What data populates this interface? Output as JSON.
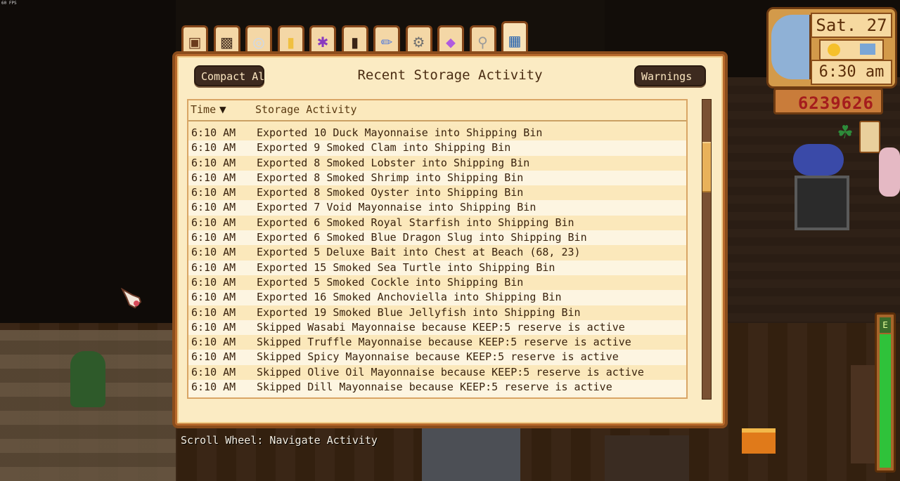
{
  "overlay": {
    "fps_label": "60 FPS"
  },
  "hud": {
    "date": "Sat. 27",
    "time": "6:30 am",
    "money": "6239626"
  },
  "tabs": [
    {
      "name": "tab-chest-icon",
      "color": "#6b3b1c"
    },
    {
      "name": "tab-tiki-icon",
      "color": "#4a3322"
    },
    {
      "name": "tab-ring-icon",
      "color": "#c8d8f0"
    },
    {
      "name": "tab-tag-icon",
      "color": "#f0c040"
    },
    {
      "name": "tab-star-figure-icon",
      "color": "#8a3ac0"
    },
    {
      "name": "tab-barrel-icon",
      "color": "#3a2416"
    },
    {
      "name": "tab-wand-icon",
      "color": "#5a7fd8"
    },
    {
      "name": "tab-gear-icon",
      "color": "#6f6f6f"
    },
    {
      "name": "tab-gem-icon",
      "color": "#b05ae0"
    },
    {
      "name": "tab-magnifier-icon",
      "color": "#9a9a9a"
    },
    {
      "name": "tab-book-icon",
      "color": "#1f5fb0"
    }
  ],
  "panel": {
    "title": "Recent Storage Activity",
    "compact_label": "Compact All",
    "warnings_label": "Warnings",
    "columns": {
      "time": "Time",
      "activity": "Storage Activity"
    }
  },
  "rows": [
    {
      "time": "6:10 AM",
      "activity": "Exported 10 Duck Mayonnaise into Shipping Bin"
    },
    {
      "time": "6:10 AM",
      "activity": "Exported 9 Smoked Clam into Shipping Bin"
    },
    {
      "time": "6:10 AM",
      "activity": "Exported 8 Smoked Lobster into Shipping Bin"
    },
    {
      "time": "6:10 AM",
      "activity": "Exported 8 Smoked Shrimp into Shipping Bin"
    },
    {
      "time": "6:10 AM",
      "activity": "Exported 8 Smoked Oyster into Shipping Bin"
    },
    {
      "time": "6:10 AM",
      "activity": "Exported 7 Void Mayonnaise into Shipping Bin"
    },
    {
      "time": "6:10 AM",
      "activity": "Exported 6 Smoked Royal Starfish into Shipping Bin"
    },
    {
      "time": "6:10 AM",
      "activity": "Exported 6 Smoked Blue Dragon Slug into Shipping Bin"
    },
    {
      "time": "6:10 AM",
      "activity": "Exported 5 Deluxe Bait into Chest at Beach (68, 23)"
    },
    {
      "time": "6:10 AM",
      "activity": "Exported 15 Smoked Sea Turtle into Shipping Bin"
    },
    {
      "time": "6:10 AM",
      "activity": "Exported 5 Smoked Cockle into Shipping Bin"
    },
    {
      "time": "6:10 AM",
      "activity": "Exported 16 Smoked Anchoviella into Shipping Bin"
    },
    {
      "time": "6:10 AM",
      "activity": "Exported 19 Smoked Blue Jellyfish into Shipping Bin"
    },
    {
      "time": "6:10 AM",
      "activity": "Skipped Wasabi Mayonnaise because KEEP:5 reserve is active"
    },
    {
      "time": "6:10 AM",
      "activity": "Skipped Truffle Mayonnaise because KEEP:5 reserve is active"
    },
    {
      "time": "6:10 AM",
      "activity": "Skipped Spicy Mayonnaise because KEEP:5 reserve is active"
    },
    {
      "time": "6:10 AM",
      "activity": "Skipped Olive Oil Mayonnaise because KEEP:5 reserve is active"
    },
    {
      "time": "6:10 AM",
      "activity": "Skipped Dill Mayonnaise because KEEP:5 reserve is active"
    }
  ],
  "scrollbar": {
    "position_fraction": 0.14,
    "visible_fraction": 0.17
  },
  "hint": "Scroll Wheel: Navigate Activity"
}
